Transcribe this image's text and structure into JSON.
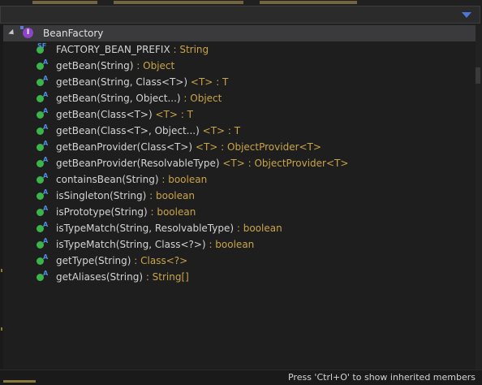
{
  "filter": {
    "value": "",
    "placeholder": ""
  },
  "root": {
    "label": "BeanFactory",
    "icon_letter": "I"
  },
  "members": [
    {
      "badge": "SF",
      "name": "FACTORY_BEAN_PREFIX",
      "generic": "",
      "return": "String"
    },
    {
      "badge": "A",
      "name": "getBean(String)",
      "generic": "",
      "return": "Object"
    },
    {
      "badge": "A",
      "name": "getBean(String, Class<T>)",
      "generic": "<T>",
      "return": "T"
    },
    {
      "badge": "A",
      "name": "getBean(String, Object...)",
      "generic": "",
      "return": "Object"
    },
    {
      "badge": "A",
      "name": "getBean(Class<T>)",
      "generic": "<T>",
      "return": "T"
    },
    {
      "badge": "A",
      "name": "getBean(Class<T>, Object...)",
      "generic": "<T>",
      "return": "T"
    },
    {
      "badge": "A",
      "name": "getBeanProvider(Class<T>)",
      "generic": "<T>",
      "return": "ObjectProvider<T>"
    },
    {
      "badge": "A",
      "name": "getBeanProvider(ResolvableType)",
      "generic": "<T>",
      "return": "ObjectProvider<T>"
    },
    {
      "badge": "A",
      "name": "containsBean(String)",
      "generic": "",
      "return": "boolean"
    },
    {
      "badge": "A",
      "name": "isSingleton(String)",
      "generic": "",
      "return": "boolean"
    },
    {
      "badge": "A",
      "name": "isPrototype(String)",
      "generic": "",
      "return": "boolean"
    },
    {
      "badge": "A",
      "name": "isTypeMatch(String, ResolvableType)",
      "generic": "",
      "return": "boolean"
    },
    {
      "badge": "A",
      "name": "isTypeMatch(String, Class<?>)",
      "generic": "",
      "return": "boolean"
    },
    {
      "badge": "A",
      "name": "getType(String)",
      "generic": "",
      "return": "Class<?>"
    },
    {
      "badge": "A",
      "name": "getAliases(String)",
      "generic": "",
      "return": "String[]"
    }
  ],
  "status": {
    "hint": "Press 'Ctrl+O' to show inherited members"
  },
  "colors": {
    "method_dot": "#3bb54a",
    "type": "#c9a44a",
    "interface_icon": "#8e44c8",
    "accent": "#4a78d8"
  }
}
